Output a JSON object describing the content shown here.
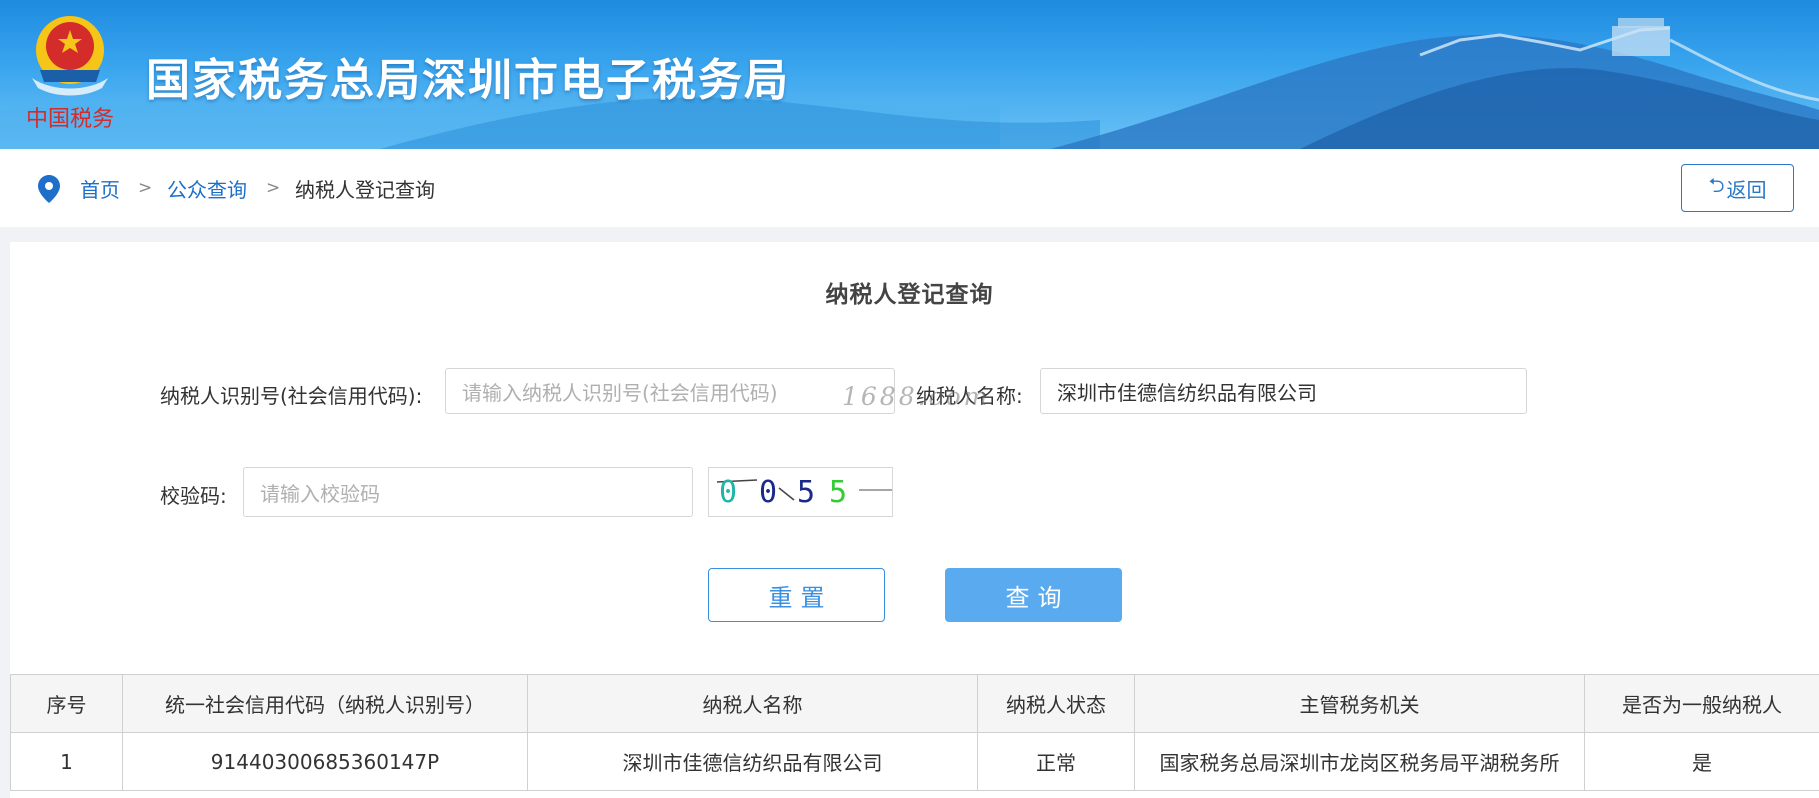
{
  "header": {
    "title": "国家税务总局深圳市电子税务局",
    "emblem_caption": "中国税务",
    "brand_color": "#1f8be0"
  },
  "breadcrumb": {
    "items": [
      "首页",
      "公众查询",
      "纳税人登记查询"
    ],
    "separator": ">",
    "back_label": "返回",
    "back_icon": "return-arrow-icon"
  },
  "form": {
    "title": "纳税人登记查询",
    "taxpayer_id": {
      "label": "纳税人识别号(社会信用代码):",
      "placeholder": "请输入纳税人识别号(社会信用代码)",
      "value": ""
    },
    "taxpayer_name": {
      "label": "纳税人名称:",
      "value": "深圳市佳德信纺织品有限公司"
    },
    "captcha": {
      "label": "校验码:",
      "placeholder": "请输入校验码",
      "value": "",
      "image_text": "0055"
    },
    "reset_label": "重置",
    "search_label": "查询",
    "watermark": "1688.com"
  },
  "table": {
    "headers": [
      "序号",
      "统一社会信用代码（纳税人识别号）",
      "纳税人名称",
      "纳税人状态",
      "主管税务机关",
      "是否为一般纳税人"
    ],
    "rows": [
      [
        "1",
        "91440300685360147P",
        "深圳市佳德信纺织品有限公司",
        "正常",
        "国家税务总局深圳市龙岗区税务局平湖税务所",
        "是"
      ]
    ]
  },
  "colors": {
    "link": "#1d6fc9",
    "primary_button": "#5aaaf0",
    "outline_button": "#3a8fe0"
  }
}
